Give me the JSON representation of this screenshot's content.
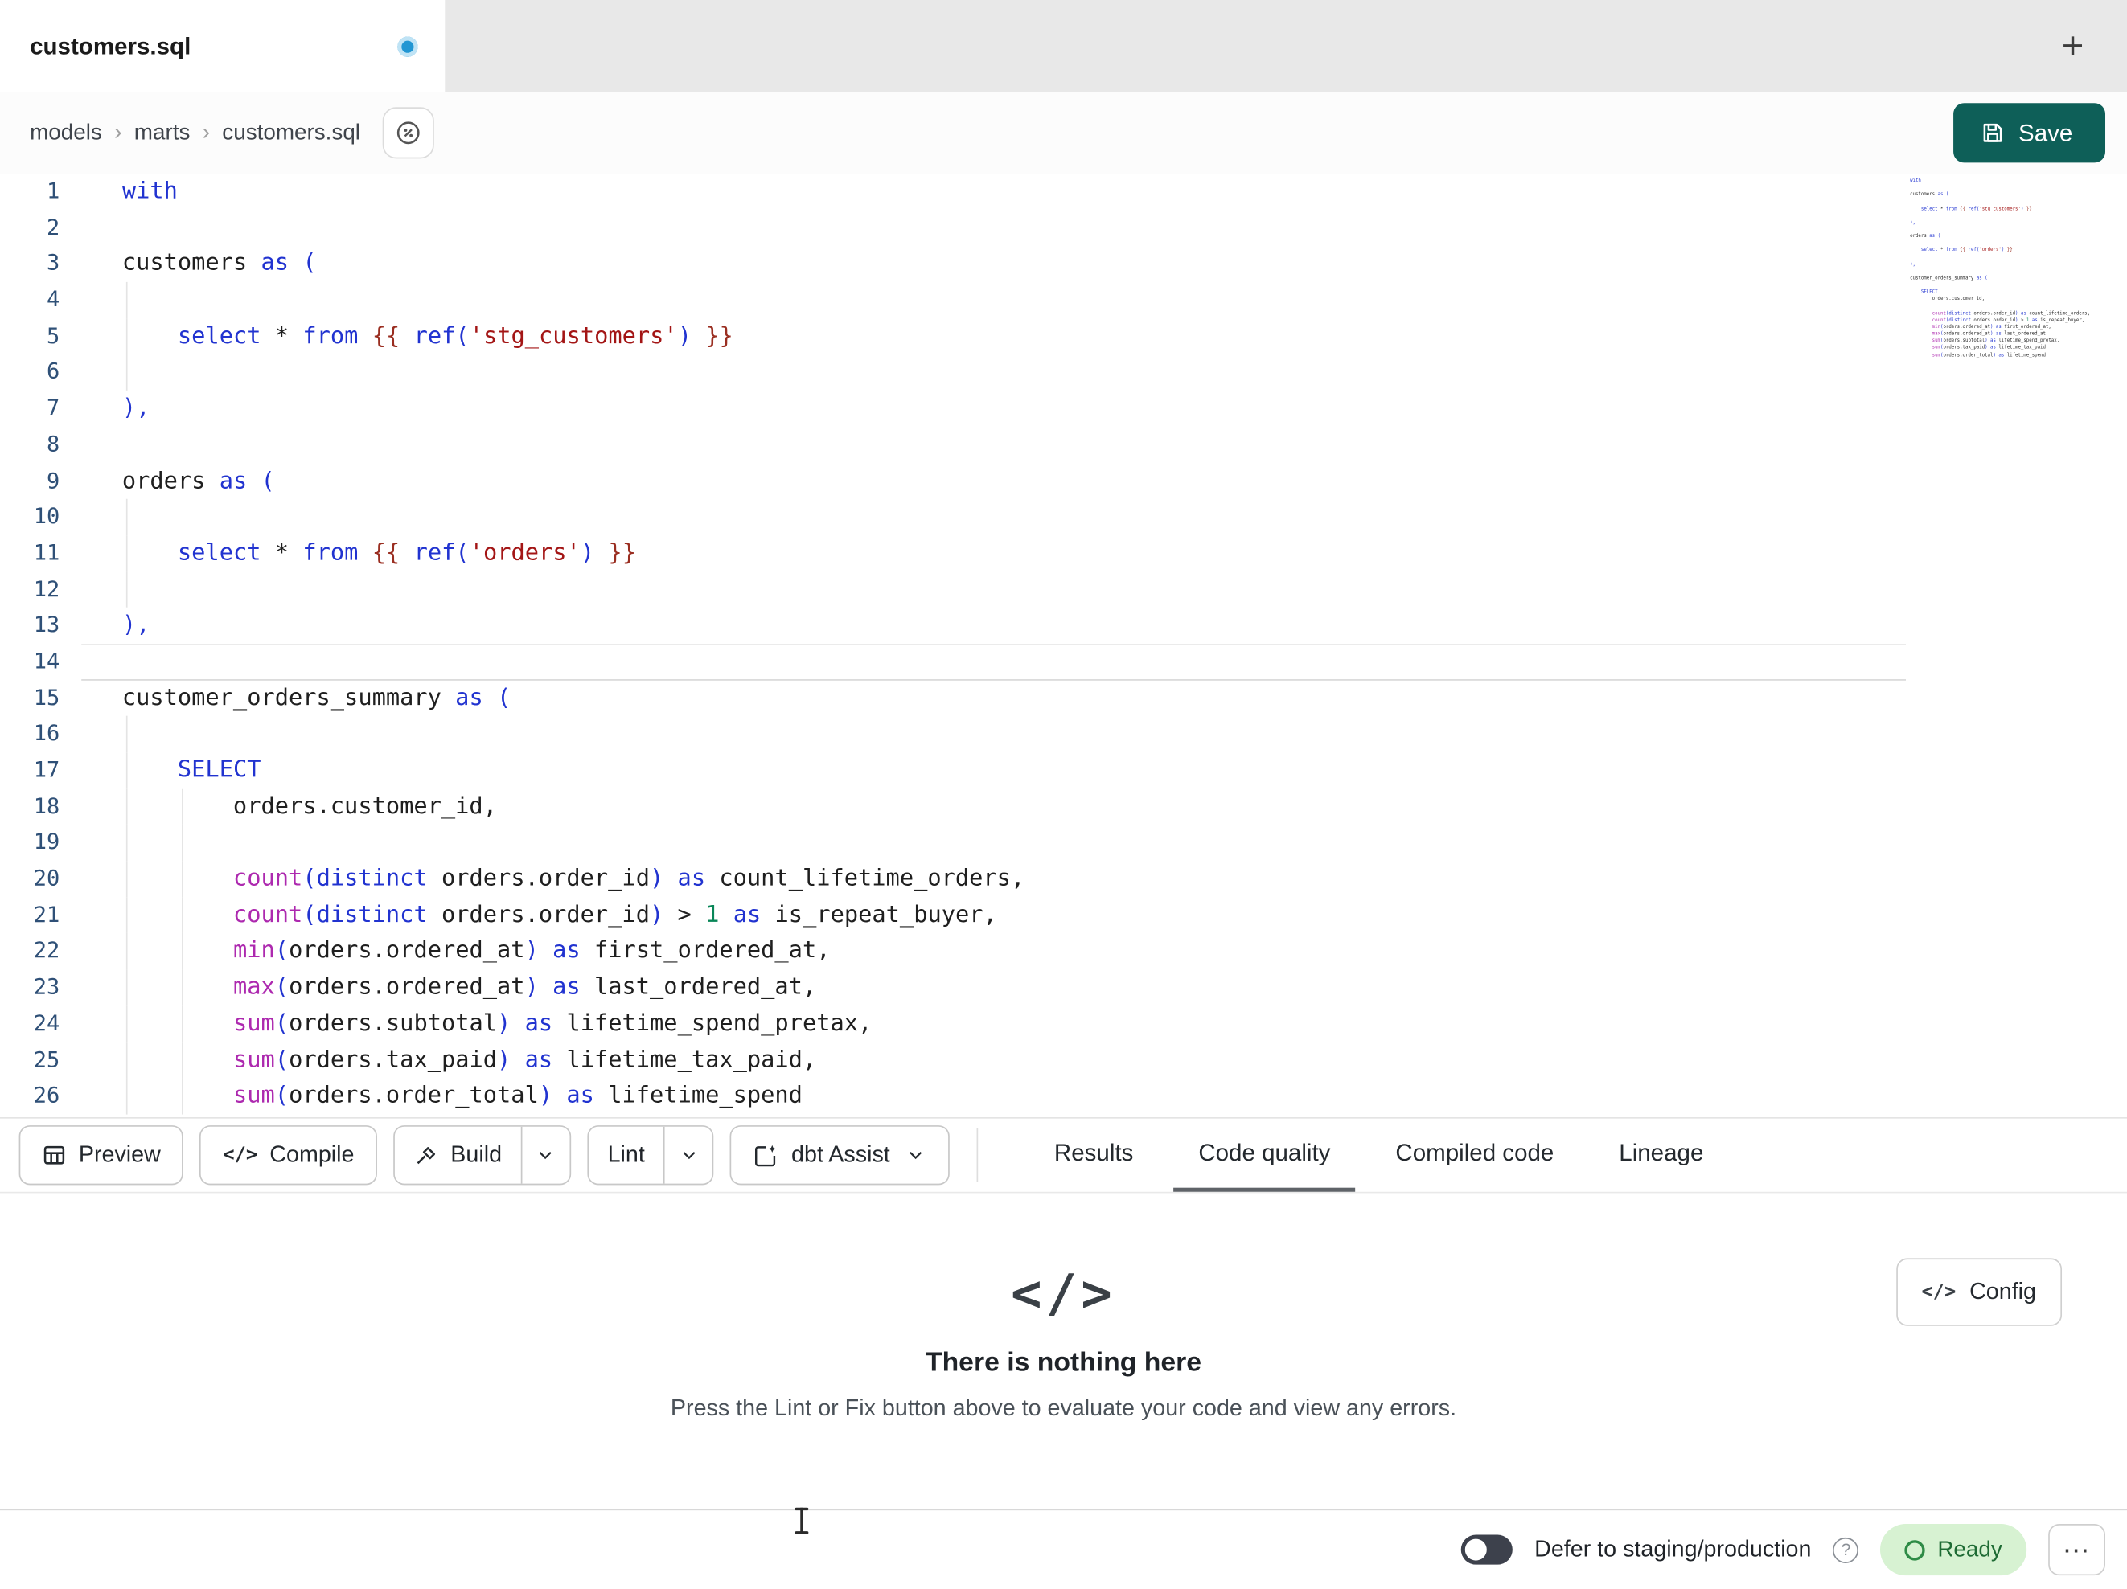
{
  "tab_bar": {
    "active_tab": "customers.sql",
    "new_tab_icon": "+"
  },
  "breadcrumb": {
    "items": [
      "models",
      "marts",
      "customers.sql"
    ],
    "separator": "›"
  },
  "save_button": {
    "label": "Save"
  },
  "toolbar": {
    "preview": "Preview",
    "compile": "Compile",
    "compile_icon": "</>",
    "build": "Build",
    "lint": "Lint",
    "dbt_assist": "dbt Assist"
  },
  "result_tabs": {
    "results": "Results",
    "code_quality": "Code quality",
    "compiled_code": "Compiled code",
    "lineage": "Lineage"
  },
  "empty_state": {
    "icon": "</>",
    "title": "There is nothing here",
    "subtitle": "Press the Lint or Fix button above to evaluate your code and view any errors.",
    "config_label": "Config",
    "config_icon": "</>"
  },
  "status_bar": {
    "defer_label": "Defer to staging/production",
    "help_icon": "?",
    "ready_label": "Ready",
    "more_icon": "⋯"
  },
  "colors": {
    "accent_teal": "#0e5f58",
    "unsaved_dot": "#2196d3",
    "ready_bg": "#d7f2d2",
    "ready_text": "#1e6b34",
    "keyword": "#2133d0",
    "function": "#ad29af",
    "string": "#a31515",
    "template": "#9a2e21",
    "number": "#098658",
    "line_number": "#2f5077"
  },
  "editor": {
    "active_line": 14,
    "lines": [
      {
        "n": 1,
        "t": [
          [
            "kw",
            "with"
          ]
        ]
      },
      {
        "n": 2,
        "t": []
      },
      {
        "n": 3,
        "t": [
          [
            "pln",
            "customers "
          ],
          [
            "kw",
            "as"
          ],
          [
            "pln",
            " "
          ],
          [
            "pun",
            "("
          ]
        ]
      },
      {
        "n": 4,
        "g": [
          0
        ],
        "t": []
      },
      {
        "n": 5,
        "g": [
          0
        ],
        "t": [
          [
            "pln",
            "    "
          ],
          [
            "kw",
            "select"
          ],
          [
            "pln",
            " "
          ],
          [
            "op",
            "*"
          ],
          [
            "pln",
            " "
          ],
          [
            "kw",
            "from"
          ],
          [
            "pln",
            " "
          ],
          [
            "tmpl",
            "{{"
          ],
          [
            "pln",
            " "
          ],
          [
            "kw",
            "ref"
          ],
          [
            "pun",
            "("
          ],
          [
            "str",
            "'stg_customers'"
          ],
          [
            "pun",
            ")"
          ],
          [
            "pln",
            " "
          ],
          [
            "tmpl",
            "}}"
          ]
        ]
      },
      {
        "n": 6,
        "g": [
          0
        ],
        "t": []
      },
      {
        "n": 7,
        "t": [
          [
            "pun",
            "),"
          ]
        ]
      },
      {
        "n": 8,
        "t": []
      },
      {
        "n": 9,
        "t": [
          [
            "pln",
            "orders "
          ],
          [
            "kw",
            "as"
          ],
          [
            "pln",
            " "
          ],
          [
            "pun",
            "("
          ]
        ]
      },
      {
        "n": 10,
        "g": [
          0
        ],
        "t": []
      },
      {
        "n": 11,
        "g": [
          0
        ],
        "t": [
          [
            "pln",
            "    "
          ],
          [
            "kw",
            "select"
          ],
          [
            "pln",
            " "
          ],
          [
            "op",
            "*"
          ],
          [
            "pln",
            " "
          ],
          [
            "kw",
            "from"
          ],
          [
            "pln",
            " "
          ],
          [
            "tmpl",
            "{{"
          ],
          [
            "pln",
            " "
          ],
          [
            "kw",
            "ref"
          ],
          [
            "pun",
            "("
          ],
          [
            "str",
            "'orders'"
          ],
          [
            "pun",
            ")"
          ],
          [
            "pln",
            " "
          ],
          [
            "tmpl",
            "}}"
          ]
        ]
      },
      {
        "n": 12,
        "g": [
          0
        ],
        "t": []
      },
      {
        "n": 13,
        "t": [
          [
            "pun",
            "),"
          ]
        ]
      },
      {
        "n": 14,
        "t": []
      },
      {
        "n": 15,
        "t": [
          [
            "pln",
            "customer_orders_summary "
          ],
          [
            "kw",
            "as"
          ],
          [
            "pln",
            " "
          ],
          [
            "pun",
            "("
          ]
        ]
      },
      {
        "n": 16,
        "g": [
          0
        ],
        "t": []
      },
      {
        "n": 17,
        "g": [
          0
        ],
        "t": [
          [
            "pln",
            "    "
          ],
          [
            "kw",
            "SELECT"
          ]
        ]
      },
      {
        "n": 18,
        "g": [
          0,
          4
        ],
        "t": [
          [
            "pln",
            "        orders.customer_id,"
          ]
        ]
      },
      {
        "n": 19,
        "g": [
          0,
          4
        ],
        "t": []
      },
      {
        "n": 20,
        "g": [
          0,
          4
        ],
        "t": [
          [
            "pln",
            "        "
          ],
          [
            "fn",
            "count"
          ],
          [
            "pun",
            "("
          ],
          [
            "kw",
            "distinct"
          ],
          [
            "pln",
            " orders.order_id"
          ],
          [
            "pun",
            ")"
          ],
          [
            "pln",
            " "
          ],
          [
            "kw",
            "as"
          ],
          [
            "pln",
            " count_lifetime_orders,"
          ]
        ]
      },
      {
        "n": 21,
        "g": [
          0,
          4
        ],
        "t": [
          [
            "pln",
            "        "
          ],
          [
            "fn",
            "count"
          ],
          [
            "pun",
            "("
          ],
          [
            "kw",
            "distinct"
          ],
          [
            "pln",
            " orders.order_id"
          ],
          [
            "pun",
            ")"
          ],
          [
            "pln",
            " "
          ],
          [
            "op",
            ">"
          ],
          [
            "pln",
            " "
          ],
          [
            "num",
            "1"
          ],
          [
            "pln",
            " "
          ],
          [
            "kw",
            "as"
          ],
          [
            "pln",
            " is_repeat_buyer,"
          ]
        ]
      },
      {
        "n": 22,
        "g": [
          0,
          4
        ],
        "t": [
          [
            "pln",
            "        "
          ],
          [
            "fn",
            "min"
          ],
          [
            "pun",
            "("
          ],
          [
            "pln",
            "orders.ordered_at"
          ],
          [
            "pun",
            ")"
          ],
          [
            "pln",
            " "
          ],
          [
            "kw",
            "as"
          ],
          [
            "pln",
            " first_ordered_at,"
          ]
        ]
      },
      {
        "n": 23,
        "g": [
          0,
          4
        ],
        "t": [
          [
            "pln",
            "        "
          ],
          [
            "fn",
            "max"
          ],
          [
            "pun",
            "("
          ],
          [
            "pln",
            "orders.ordered_at"
          ],
          [
            "pun",
            ")"
          ],
          [
            "pln",
            " "
          ],
          [
            "kw",
            "as"
          ],
          [
            "pln",
            " last_ordered_at,"
          ]
        ]
      },
      {
        "n": 24,
        "g": [
          0,
          4
        ],
        "t": [
          [
            "pln",
            "        "
          ],
          [
            "fn",
            "sum"
          ],
          [
            "pun",
            "("
          ],
          [
            "pln",
            "orders.subtotal"
          ],
          [
            "pun",
            ")"
          ],
          [
            "pln",
            " "
          ],
          [
            "kw",
            "as"
          ],
          [
            "pln",
            " lifetime_spend_pretax,"
          ]
        ]
      },
      {
        "n": 25,
        "g": [
          0,
          4
        ],
        "t": [
          [
            "pln",
            "        "
          ],
          [
            "fn",
            "sum"
          ],
          [
            "pun",
            "("
          ],
          [
            "pln",
            "orders.tax_paid"
          ],
          [
            "pun",
            ")"
          ],
          [
            "pln",
            " "
          ],
          [
            "kw",
            "as"
          ],
          [
            "pln",
            " lifetime_tax_paid,"
          ]
        ]
      },
      {
        "n": 26,
        "g": [
          0,
          4
        ],
        "t": [
          [
            "pln",
            "        "
          ],
          [
            "fn",
            "sum"
          ],
          [
            "pun",
            "("
          ],
          [
            "pln",
            "orders.order_total"
          ],
          [
            "pun",
            ")"
          ],
          [
            "pln",
            " "
          ],
          [
            "kw",
            "as"
          ],
          [
            "pln",
            " lifetime_spend"
          ]
        ]
      }
    ]
  }
}
